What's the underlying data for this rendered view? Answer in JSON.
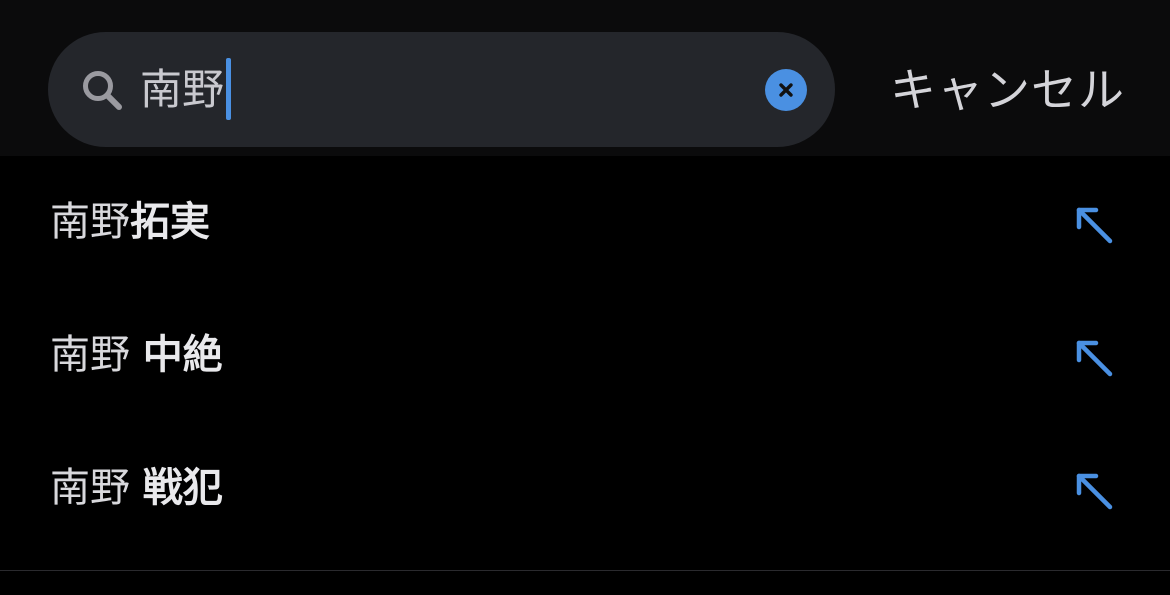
{
  "search": {
    "query": "南野",
    "cancel_label": "キャンセル"
  },
  "suggestions": [
    {
      "prefix": "南野",
      "completion": "拓実"
    },
    {
      "prefix": "南野 ",
      "completion": "中絶"
    },
    {
      "prefix": "南野 ",
      "completion": "戦犯"
    }
  ],
  "colors": {
    "accent": "#4a90e2",
    "background": "#000000",
    "search_field": "#24262b"
  },
  "icons": {
    "search": "search-icon",
    "clear": "clear-icon",
    "suggestion_fill": "arrow-up-left-icon"
  }
}
